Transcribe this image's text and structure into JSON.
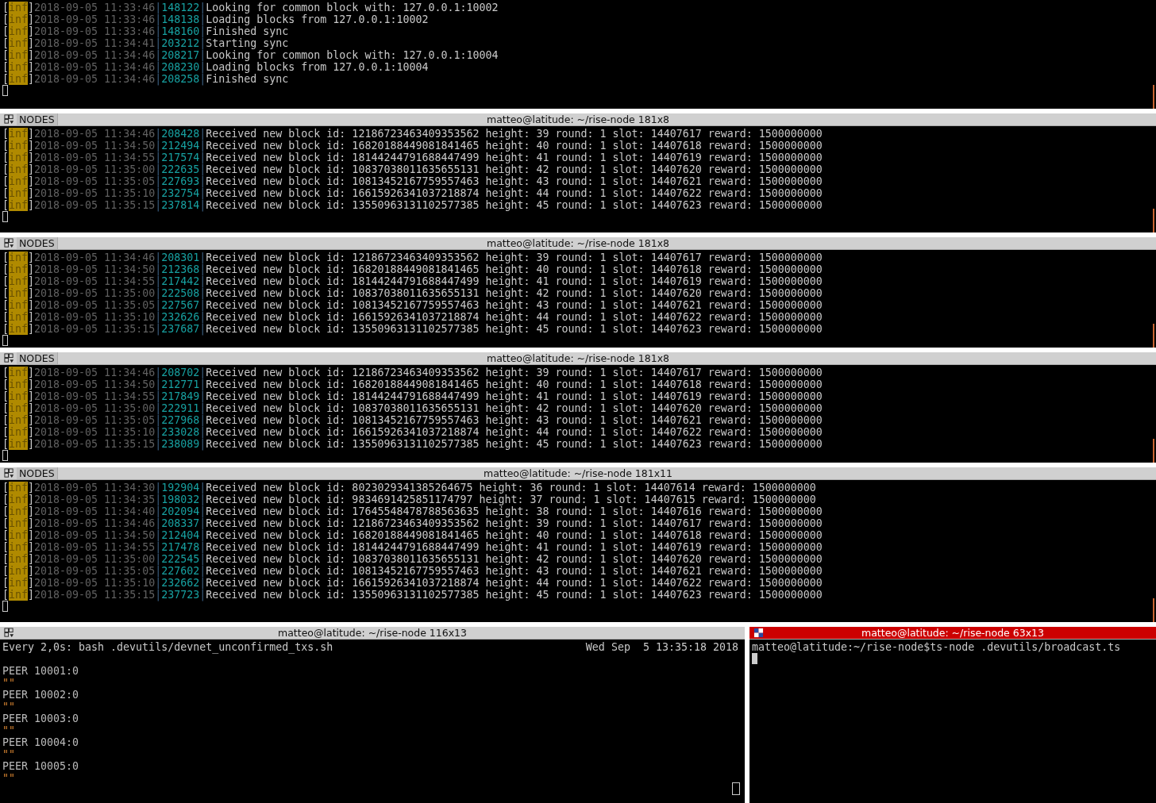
{
  "panes": [
    {
      "kind": "log",
      "lines": [
        {
          "open": "[",
          "level": "inf",
          "close": "]",
          "time": "2018-09-05 11:33:46",
          "sep1": "|",
          "tick": "148122",
          "sep2": "|",
          "message": "Looking for common block with: 127.0.0.1:10002"
        },
        {
          "open": "[",
          "level": "inf",
          "close": "]",
          "time": "2018-09-05 11:33:46",
          "sep1": "|",
          "tick": "148138",
          "sep2": "|",
          "message": "Loading blocks from 127.0.0.1:10002"
        },
        {
          "open": "[",
          "level": "inf",
          "close": "]",
          "time": "2018-09-05 11:33:46",
          "sep1": "|",
          "tick": "148160",
          "sep2": "|",
          "message": "Finished sync"
        },
        {
          "open": "[",
          "level": "inf",
          "close": "]",
          "time": "2018-09-05 11:34:41",
          "sep1": "|",
          "tick": "203212",
          "sep2": "|",
          "message": "Starting sync"
        },
        {
          "open": "[",
          "level": "inf",
          "close": "]",
          "time": "2018-09-05 11:34:46",
          "sep1": "|",
          "tick": "208217",
          "sep2": "|",
          "message": "Looking for common block with: 127.0.0.1:10004"
        },
        {
          "open": "[",
          "level": "inf",
          "close": "]",
          "time": "2018-09-05 11:34:46",
          "sep1": "|",
          "tick": "208230",
          "sep2": "|",
          "message": "Loading blocks from 127.0.0.1:10004"
        },
        {
          "open": "[",
          "level": "inf",
          "close": "]",
          "time": "2018-09-05 11:34:46",
          "sep1": "|",
          "tick": "208258",
          "sep2": "|",
          "message": "Finished sync"
        }
      ]
    },
    {
      "kind": "log",
      "tab": "NODES",
      "title": "matteo@latitude: ~/rise-node 181x8",
      "focused": false,
      "lines": [
        {
          "open": "[",
          "level": "inf",
          "close": "]",
          "time": "2018-09-05 11:34:46",
          "sep1": "|",
          "tick": "208428",
          "sep2": "|",
          "message": "Received new block id: 12186723463409353562 height: 39 round: 1 slot: 14407617 reward: 1500000000"
        },
        {
          "open": "[",
          "level": "inf",
          "close": "]",
          "time": "2018-09-05 11:34:50",
          "sep1": "|",
          "tick": "212494",
          "sep2": "|",
          "message": "Received new block id: 16820188449081841465 height: 40 round: 1 slot: 14407618 reward: 1500000000"
        },
        {
          "open": "[",
          "level": "inf",
          "close": "]",
          "time": "2018-09-05 11:34:55",
          "sep1": "|",
          "tick": "217574",
          "sep2": "|",
          "message": "Received new block id: 18144244791688447499 height: 41 round: 1 slot: 14407619 reward: 1500000000"
        },
        {
          "open": "[",
          "level": "inf",
          "close": "]",
          "time": "2018-09-05 11:35:00",
          "sep1": "|",
          "tick": "222635",
          "sep2": "|",
          "message": "Received new block id: 10837038011635655131 height: 42 round: 1 slot: 14407620 reward: 1500000000"
        },
        {
          "open": "[",
          "level": "inf",
          "close": "]",
          "time": "2018-09-05 11:35:05",
          "sep1": "|",
          "tick": "227693",
          "sep2": "|",
          "message": "Received new block id: 10813452167759557463 height: 43 round: 1 slot: 14407621 reward: 1500000000"
        },
        {
          "open": "[",
          "level": "inf",
          "close": "]",
          "time": "2018-09-05 11:35:10",
          "sep1": "|",
          "tick": "232754",
          "sep2": "|",
          "message": "Received new block id: 16615926341037218874 height: 44 round: 1 slot: 14407622 reward: 1500000000"
        },
        {
          "open": "[",
          "level": "inf",
          "close": "]",
          "time": "2018-09-05 11:35:15",
          "sep1": "|",
          "tick": "237814",
          "sep2": "|",
          "message": "Received new block id: 13550963131102577385 height: 45 round: 1 slot: 14407623 reward: 1500000000"
        }
      ]
    },
    {
      "kind": "log",
      "tab": "NODES",
      "title": "matteo@latitude: ~/rise-node 181x8",
      "focused": false,
      "lines": [
        {
          "open": "[",
          "level": "inf",
          "close": "]",
          "time": "2018-09-05 11:34:46",
          "sep1": "|",
          "tick": "208301",
          "sep2": "|",
          "message": "Received new block id: 12186723463409353562 height: 39 round: 1 slot: 14407617 reward: 1500000000"
        },
        {
          "open": "[",
          "level": "inf",
          "close": "]",
          "time": "2018-09-05 11:34:50",
          "sep1": "|",
          "tick": "212368",
          "sep2": "|",
          "message": "Received new block id: 16820188449081841465 height: 40 round: 1 slot: 14407618 reward: 1500000000"
        },
        {
          "open": "[",
          "level": "inf",
          "close": "]",
          "time": "2018-09-05 11:34:55",
          "sep1": "|",
          "tick": "217442",
          "sep2": "|",
          "message": "Received new block id: 18144244791688447499 height: 41 round: 1 slot: 14407619 reward: 1500000000"
        },
        {
          "open": "[",
          "level": "inf",
          "close": "]",
          "time": "2018-09-05 11:35:00",
          "sep1": "|",
          "tick": "222508",
          "sep2": "|",
          "message": "Received new block id: 10837038011635655131 height: 42 round: 1 slot: 14407620 reward: 1500000000"
        },
        {
          "open": "[",
          "level": "inf",
          "close": "]",
          "time": "2018-09-05 11:35:05",
          "sep1": "|",
          "tick": "227567",
          "sep2": "|",
          "message": "Received new block id: 10813452167759557463 height: 43 round: 1 slot: 14407621 reward: 1500000000"
        },
        {
          "open": "[",
          "level": "inf",
          "close": "]",
          "time": "2018-09-05 11:35:10",
          "sep1": "|",
          "tick": "232626",
          "sep2": "|",
          "message": "Received new block id: 16615926341037218874 height: 44 round: 1 slot: 14407622 reward: 1500000000"
        },
        {
          "open": "[",
          "level": "inf",
          "close": "]",
          "time": "2018-09-05 11:35:15",
          "sep1": "|",
          "tick": "237687",
          "sep2": "|",
          "message": "Received new block id: 13550963131102577385 height: 45 round: 1 slot: 14407623 reward: 1500000000"
        }
      ]
    },
    {
      "kind": "log",
      "tab": "NODES",
      "title": "matteo@latitude: ~/rise-node 181x8",
      "focused": false,
      "lines": [
        {
          "open": "[",
          "level": "inf",
          "close": "]",
          "time": "2018-09-05 11:34:46",
          "sep1": "|",
          "tick": "208702",
          "sep2": "|",
          "message": "Received new block id: 12186723463409353562 height: 39 round: 1 slot: 14407617 reward: 1500000000"
        },
        {
          "open": "[",
          "level": "inf",
          "close": "]",
          "time": "2018-09-05 11:34:50",
          "sep1": "|",
          "tick": "212771",
          "sep2": "|",
          "message": "Received new block id: 16820188449081841465 height: 40 round: 1 slot: 14407618 reward: 1500000000"
        },
        {
          "open": "[",
          "level": "inf",
          "close": "]",
          "time": "2018-09-05 11:34:55",
          "sep1": "|",
          "tick": "217849",
          "sep2": "|",
          "message": "Received new block id: 18144244791688447499 height: 41 round: 1 slot: 14407619 reward: 1500000000"
        },
        {
          "open": "[",
          "level": "inf",
          "close": "]",
          "time": "2018-09-05 11:35:00",
          "sep1": "|",
          "tick": "222911",
          "sep2": "|",
          "message": "Received new block id: 10837038011635655131 height: 42 round: 1 slot: 14407620 reward: 1500000000"
        },
        {
          "open": "[",
          "level": "inf",
          "close": "]",
          "time": "2018-09-05 11:35:05",
          "sep1": "|",
          "tick": "227968",
          "sep2": "|",
          "message": "Received new block id: 10813452167759557463 height: 43 round: 1 slot: 14407621 reward: 1500000000"
        },
        {
          "open": "[",
          "level": "inf",
          "close": "]",
          "time": "2018-09-05 11:35:10",
          "sep1": "|",
          "tick": "233028",
          "sep2": "|",
          "message": "Received new block id: 16615926341037218874 height: 44 round: 1 slot: 14407622 reward: 1500000000"
        },
        {
          "open": "[",
          "level": "inf",
          "close": "]",
          "time": "2018-09-05 11:35:15",
          "sep1": "|",
          "tick": "238089",
          "sep2": "|",
          "message": "Received new block id: 13550963131102577385 height: 45 round: 1 slot: 14407623 reward: 1500000000"
        }
      ]
    },
    {
      "kind": "log",
      "tab": "NODES",
      "title": "matteo@latitude: ~/rise-node 181x11",
      "focused": false,
      "lines": [
        {
          "open": "[",
          "level": "inf",
          "close": "]",
          "time": "2018-09-05 11:34:30",
          "sep1": "|",
          "tick": "192904",
          "sep2": "|",
          "message": "Received new block id: 8023029341385264675 height: 36 round: 1 slot: 14407614 reward: 1500000000"
        },
        {
          "open": "[",
          "level": "inf",
          "close": "]",
          "time": "2018-09-05 11:34:35",
          "sep1": "|",
          "tick": "198032",
          "sep2": "|",
          "message": "Received new block id: 9834691425851174797 height: 37 round: 1 slot: 14407615 reward: 1500000000"
        },
        {
          "open": "[",
          "level": "inf",
          "close": "]",
          "time": "2018-09-05 11:34:40",
          "sep1": "|",
          "tick": "202094",
          "sep2": "|",
          "message": "Received new block id: 17645548478788563635 height: 38 round: 1 slot: 14407616 reward: 1500000000"
        },
        {
          "open": "[",
          "level": "inf",
          "close": "]",
          "time": "2018-09-05 11:34:46",
          "sep1": "|",
          "tick": "208337",
          "sep2": "|",
          "message": "Received new block id: 12186723463409353562 height: 39 round: 1 slot: 14407617 reward: 1500000000"
        },
        {
          "open": "[",
          "level": "inf",
          "close": "]",
          "time": "2018-09-05 11:34:50",
          "sep1": "|",
          "tick": "212404",
          "sep2": "|",
          "message": "Received new block id: 16820188449081841465 height: 40 round: 1 slot: 14407618 reward: 1500000000"
        },
        {
          "open": "[",
          "level": "inf",
          "close": "]",
          "time": "2018-09-05 11:34:55",
          "sep1": "|",
          "tick": "217478",
          "sep2": "|",
          "message": "Received new block id: 18144244791688447499 height: 41 round: 1 slot: 14407619 reward: 1500000000"
        },
        {
          "open": "[",
          "level": "inf",
          "close": "]",
          "time": "2018-09-05 11:35:00",
          "sep1": "|",
          "tick": "222545",
          "sep2": "|",
          "message": "Received new block id: 10837038011635655131 height: 42 round: 1 slot: 14407620 reward: 1500000000"
        },
        {
          "open": "[",
          "level": "inf",
          "close": "]",
          "time": "2018-09-05 11:35:05",
          "sep1": "|",
          "tick": "227602",
          "sep2": "|",
          "message": "Received new block id: 10813452167759557463 height: 43 round: 1 slot: 14407621 reward: 1500000000"
        },
        {
          "open": "[",
          "level": "inf",
          "close": "]",
          "time": "2018-09-05 11:35:10",
          "sep1": "|",
          "tick": "232662",
          "sep2": "|",
          "message": "Received new block id: 16615926341037218874 height: 44 round: 1 slot: 14407622 reward: 1500000000"
        },
        {
          "open": "[",
          "level": "inf",
          "close": "]",
          "time": "2018-09-05 11:35:15",
          "sep1": "|",
          "tick": "237723",
          "sep2": "|",
          "message": "Received new block id: 13550963131102577385 height: 45 round: 1 slot: 14407623 reward: 1500000000"
        }
      ]
    }
  ],
  "bottom": [
    {
      "kind": "watch",
      "title": "matteo@latitude: ~/rise-node 116x13",
      "focused": false,
      "command": "Every 2,0s: bash .devutils/devnet_unconfirmed_txs.sh",
      "clock": "Wed Sep  5 13:35:18 2018",
      "lines": [
        {
          "kind": "peer",
          "text": "PEER 10001:0"
        },
        {
          "kind": "quote",
          "text": "\"\""
        },
        {
          "kind": "peer",
          "text": "PEER 10002:0"
        },
        {
          "kind": "quote",
          "text": "\"\""
        },
        {
          "kind": "peer",
          "text": "PEER 10003:0"
        },
        {
          "kind": "quote",
          "text": "\"\""
        },
        {
          "kind": "peer",
          "text": "PEER 10004:0"
        },
        {
          "kind": "quote",
          "text": "\"\""
        },
        {
          "kind": "peer",
          "text": "PEER 10005:0"
        },
        {
          "kind": "quote",
          "text": "\"\""
        }
      ]
    },
    {
      "kind": "shell",
      "title": "matteo@latitude: ~/rise-node 63x13",
      "focused": true,
      "prompt": "matteo@latitude:~/rise-node$",
      "command": "ts-node .devutils/broadcast.ts"
    }
  ]
}
